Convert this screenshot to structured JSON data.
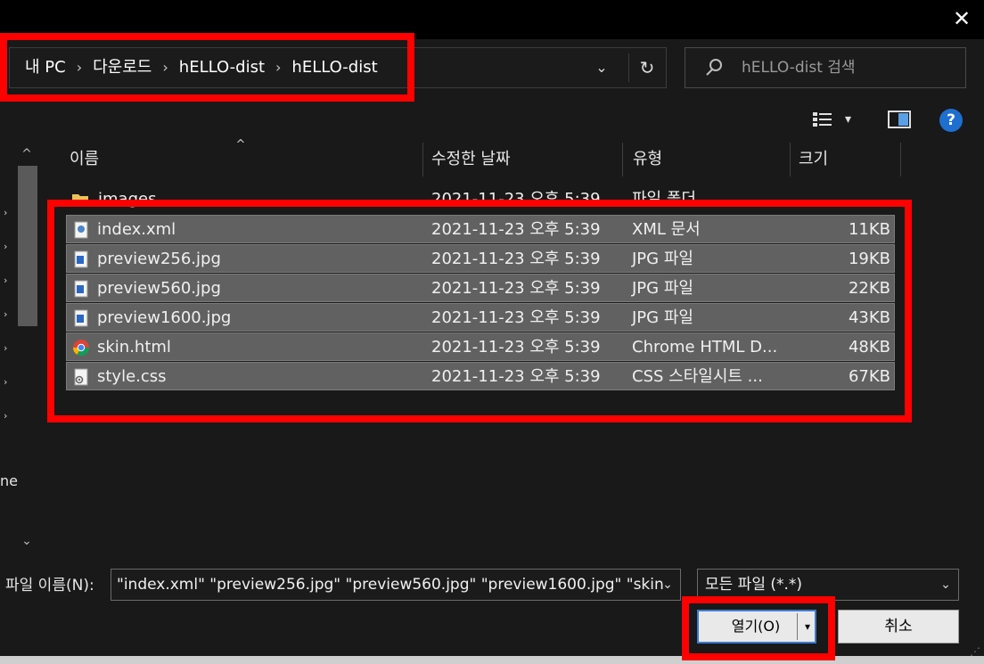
{
  "window": {
    "close_glyph": "✕"
  },
  "address": {
    "crumbs": [
      "내 PC",
      "다운로드",
      "hELLO-dist",
      "hELLO-dist"
    ],
    "separator": "›",
    "dropdown_glyph": "⌄",
    "refresh_glyph": "↻"
  },
  "search": {
    "placeholder": "hELLO-dist 검색",
    "icon": "search-icon"
  },
  "toolbar": {
    "view_caret": "▾",
    "help_label": "?"
  },
  "nav": {
    "up_glyph": "^",
    "down_glyph": "⌄",
    "partial_label": "ne"
  },
  "columns": {
    "name": "이름",
    "date": "수정한 날짜",
    "type": "유형",
    "size": "크기",
    "sort_glyph": "^"
  },
  "folder_row": {
    "name": "images",
    "date": "2021-11-23 오후 5:39",
    "type": "파일 폴더"
  },
  "files": [
    {
      "name": "index.xml",
      "date": "2021-11-23 오후 5:39",
      "type": "XML 문서",
      "size": "11KB",
      "icon": "xml-file-icon"
    },
    {
      "name": "preview256.jpg",
      "date": "2021-11-23 오후 5:39",
      "type": "JPG 파일",
      "size": "19KB",
      "icon": "image-file-icon"
    },
    {
      "name": "preview560.jpg",
      "date": "2021-11-23 오후 5:39",
      "type": "JPG 파일",
      "size": "22KB",
      "icon": "image-file-icon"
    },
    {
      "name": "preview1600.jpg",
      "date": "2021-11-23 오후 5:39",
      "type": "JPG 파일",
      "size": "43KB",
      "icon": "image-file-icon"
    },
    {
      "name": "skin.html",
      "date": "2021-11-23 오후 5:39",
      "type": "Chrome HTML D...",
      "size": "48KB",
      "icon": "chrome-icon"
    },
    {
      "name": "style.css",
      "date": "2021-11-23 오후 5:39",
      "type": "CSS 스타일시트 ...",
      "size": "67KB",
      "icon": "css-file-icon"
    }
  ],
  "bottom": {
    "filename_label": "파일 이름(N):",
    "filename_value": "\"index.xml\" \"preview256.jpg\" \"preview560.jpg\" \"preview1600.jpg\" \"skin",
    "dropdown_glyph": "⌄",
    "filetype_value": "모든 파일 (*.*)",
    "open_label": "열기(O)",
    "open_caret": "▾",
    "cancel_label": "취소",
    "grip_glyph": "⋰"
  },
  "colors": {
    "background": "#191919",
    "selected_row": "#616161",
    "annotation": "#ff0000",
    "accent": "#3c7bd0"
  }
}
